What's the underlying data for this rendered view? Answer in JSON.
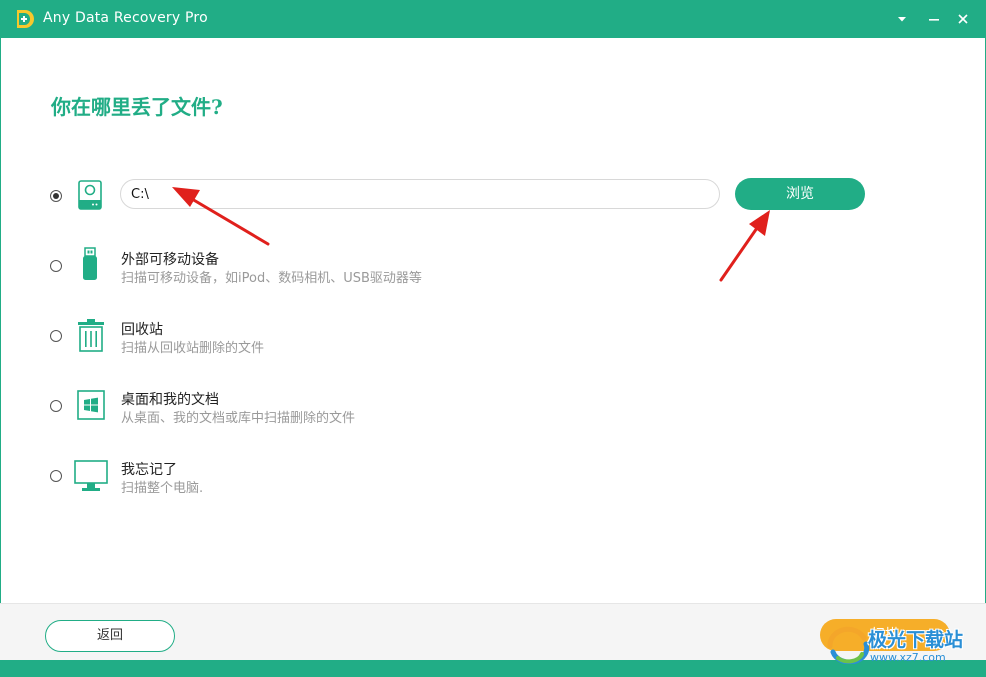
{
  "window": {
    "title": "Any Data Recovery Pro"
  },
  "colors": {
    "brand": "#21ad86",
    "scan_button": "#f6ae29",
    "subtitle_text": "#9a9a9a",
    "annotation_arrow": "#e0201c"
  },
  "main": {
    "heading": "你在哪里丢了文件?",
    "path_input": {
      "value": "C:\\"
    },
    "browse_label": "浏览",
    "options": [
      {
        "icon": "hard-drive-icon",
        "selected": true
      },
      {
        "icon": "usb-drive-icon",
        "title": "外部可移动设备",
        "subtitle": "扫描可移动设备，如iPod、数码相机、USB驱动器等"
      },
      {
        "icon": "recycle-bin-icon",
        "title": "回收站",
        "subtitle": "扫描从回收站删除的文件"
      },
      {
        "icon": "desktop-documents-icon",
        "title": "桌面和我的文档",
        "subtitle": "从桌面、我的文档或库中扫描删除的文件"
      },
      {
        "icon": "computer-monitor-icon",
        "title": "我忘记了",
        "subtitle": "扫描整个电脑."
      }
    ]
  },
  "footer": {
    "back_label": "返回",
    "scan_label": "扫描"
  },
  "watermark": {
    "name": "极光下载站",
    "url": "www.xz7.com"
  }
}
